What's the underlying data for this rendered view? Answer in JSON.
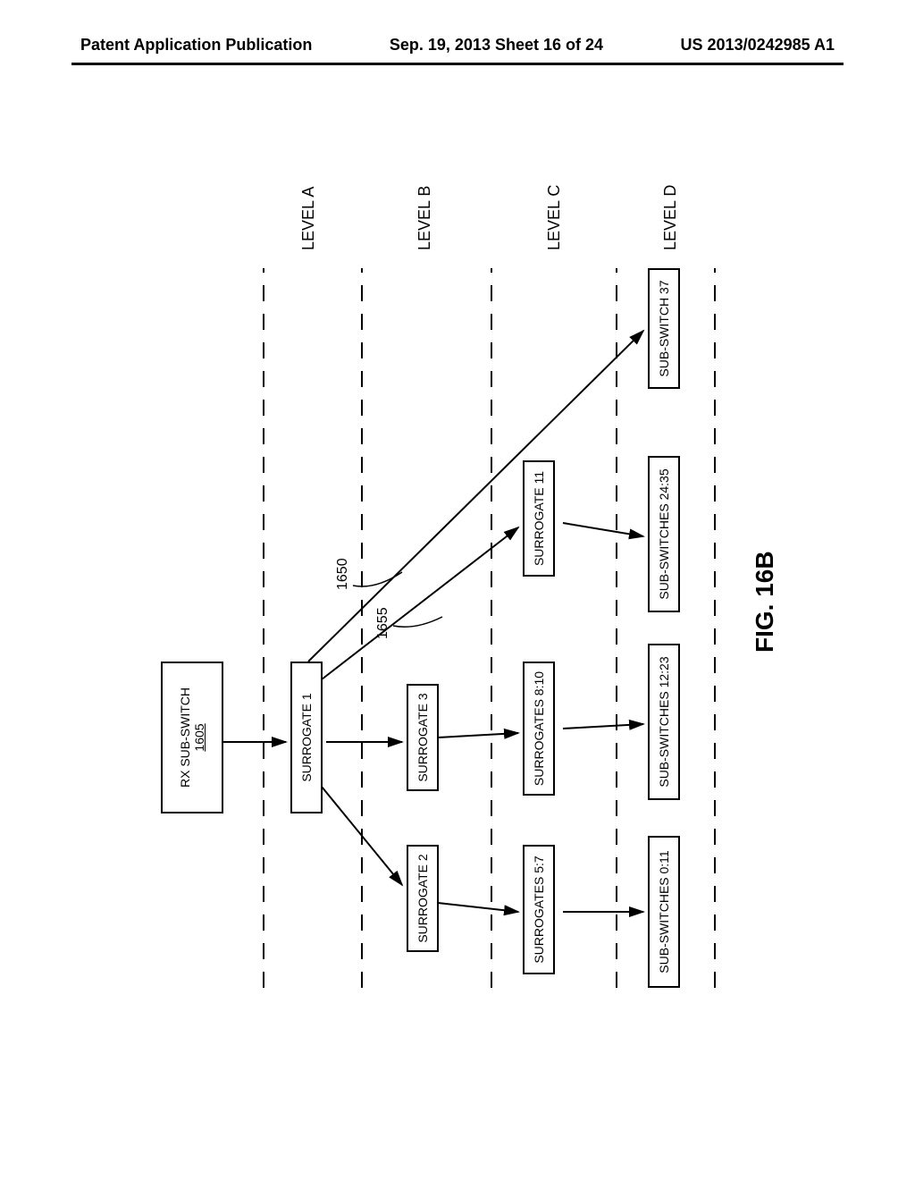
{
  "header": {
    "left": "Patent Application Publication",
    "center": "Sep. 19, 2013  Sheet 16 of 24",
    "right": "US 2013/0242985 A1"
  },
  "nodes": {
    "root_line1": "RX  SUB-SWITCH",
    "root_line2": "1605",
    "surrogate1": "SURROGATE 1",
    "surrogate2": "SURROGATE 2",
    "surrogate3": "SURROGATE 3",
    "surrogate11": "SURROGATE 11",
    "surrogates57": "SURROGATES 5:7",
    "surrogates810": "SURROGATES 8:10",
    "sub011": "SUB-SWITCHES 0:11",
    "sub1223": "SUB-SWITCHES 12:23",
    "sub2435": "SUB-SWITCHES 24:35",
    "sub37": "SUB-SWITCH 37"
  },
  "levels": {
    "a": "LEVEL A",
    "b": "LEVEL B",
    "c": "LEVEL C",
    "d": "LEVEL D"
  },
  "refs": {
    "r1650": "1650",
    "r1655": "1655"
  },
  "caption": "FIG. 16B",
  "chart_data": {
    "type": "tree",
    "title": "FIG. 16B",
    "root": {
      "id": "1605",
      "label": "RX SUB-SWITCH 1605"
    },
    "levels": [
      "LEVEL A",
      "LEVEL B",
      "LEVEL C",
      "LEVEL D"
    ],
    "edges": [
      {
        "from": "RX SUB-SWITCH 1605",
        "to": "SURROGATE 1"
      },
      {
        "from": "SURROGATE 1",
        "to": "SURROGATE 2"
      },
      {
        "from": "SURROGATE 1",
        "to": "SURROGATE 3"
      },
      {
        "from": "SURROGATE 1",
        "to": "SURROGATE 11",
        "ref": "1655"
      },
      {
        "from": "SURROGATE 1",
        "to": "SUB-SWITCH 37",
        "ref": "1650"
      },
      {
        "from": "SURROGATE 2",
        "to": "SURROGATES 5:7"
      },
      {
        "from": "SURROGATE 3",
        "to": "SURROGATES 8:10"
      },
      {
        "from": "SURROGATES 5:7",
        "to": "SUB-SWITCHES 0:11"
      },
      {
        "from": "SURROGATES 8:10",
        "to": "SUB-SWITCHES 12:23"
      },
      {
        "from": "SURROGATE 11",
        "to": "SUB-SWITCHES 24:35"
      }
    ],
    "level_membership": {
      "LEVEL A": [
        "SURROGATE 1"
      ],
      "LEVEL B": [
        "SURROGATE 2",
        "SURROGATE 3",
        "SURROGATE 11"
      ],
      "LEVEL C": [
        "SURROGATES 5:7",
        "SURROGATES 8:10"
      ],
      "LEVEL D": [
        "SUB-SWITCHES 0:11",
        "SUB-SWITCHES 12:23",
        "SUB-SWITCHES 24:35",
        "SUB-SWITCH 37"
      ]
    }
  }
}
